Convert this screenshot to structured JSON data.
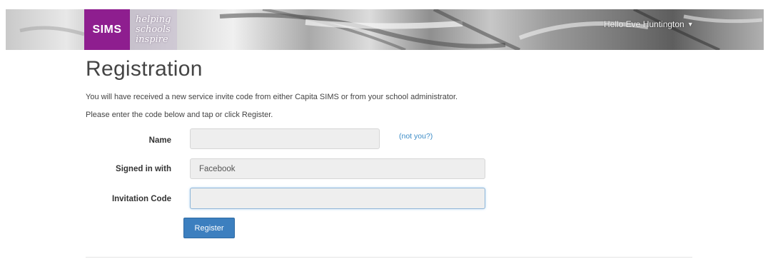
{
  "header": {
    "logo": "SIMS",
    "tagline": [
      "helping",
      "schools",
      "inspire"
    ],
    "greeting": "Hello Eve Huntington"
  },
  "page": {
    "title": "Registration",
    "intro_line1": "You will have received a new service invite code from either Capita SIMS or from your school administrator.",
    "intro_line2": "Please enter the code below and tap or click Register."
  },
  "form": {
    "name_label": "Name",
    "name_value": "",
    "not_you_link": "(not you?)",
    "signed_in_label": "Signed in with",
    "signed_in_value": "Facebook",
    "invitation_label": "Invitation Code",
    "invitation_value": "",
    "register_button": "Register"
  },
  "colors": {
    "brand_purple": "#8e1e8f",
    "button_blue": "#3c7fbf",
    "link_blue": "#3b8bc6"
  }
}
